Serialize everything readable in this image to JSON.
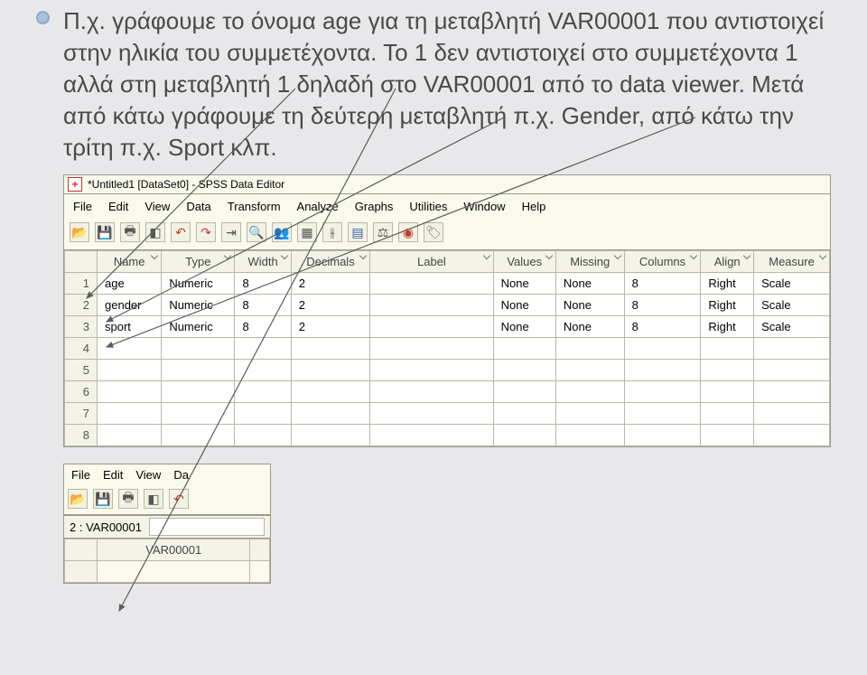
{
  "explain": {
    "text": "Π.χ. γράφουμε το όνομα age για τη μεταβλητή VAR00001 που αντιστοιχεί στην ηλικία του συμμετέχοντα. Το 1 δεν αντιστοιχεί στο συμμετέχοντα 1 αλλά στη μεταβλητή 1 δηλαδή στο VAR00001 από το data viewer. Μετά από κάτω γράφουμε τη δεύτερη μεταβλητή π.χ. Gender, από κάτω την τρίτη π.χ. Sport κλπ."
  },
  "window": {
    "title": "*Untitled1 [DataSet0] - SPSS Data Editor",
    "menus": {
      "m0": "File",
      "m1": "Edit",
      "m2": "View",
      "m3": "Data",
      "m4": "Transform",
      "m5": "Analyze",
      "m6": "Graphs",
      "m7": "Utilities",
      "m8": "Window",
      "m9": "Help"
    }
  },
  "grid": {
    "headers": {
      "c0": "Name",
      "c1": "Type",
      "c2": "Width",
      "c3": "Decimals",
      "c4": "Label",
      "c5": "Values",
      "c6": "Missing",
      "c7": "Columns",
      "c8": "Align",
      "c9": "Measure"
    },
    "rows": [
      {
        "num": "1",
        "name": "age",
        "type": "Numeric",
        "width": "8",
        "decimals": "2",
        "label": "",
        "values": "None",
        "missing": "None",
        "columns": "8",
        "align": "Right",
        "measure": "Scale"
      },
      {
        "num": "2",
        "name": "gender",
        "type": "Numeric",
        "width": "8",
        "decimals": "2",
        "label": "",
        "values": "None",
        "missing": "None",
        "columns": "8",
        "align": "Right",
        "measure": "Scale"
      },
      {
        "num": "3",
        "name": "sport",
        "type": "Numeric",
        "width": "8",
        "decimals": "2",
        "label": "",
        "values": "None",
        "missing": "None",
        "columns": "8",
        "align": "Right",
        "measure": "Scale"
      },
      {
        "num": "4"
      },
      {
        "num": "5"
      },
      {
        "num": "6"
      },
      {
        "num": "7"
      },
      {
        "num": "8"
      }
    ]
  },
  "mini": {
    "menus": {
      "m0": "File",
      "m1": "Edit",
      "m2": "View",
      "m3": "Da"
    },
    "cellref": "2 : VAR00001",
    "colhead": "VAR00001"
  }
}
